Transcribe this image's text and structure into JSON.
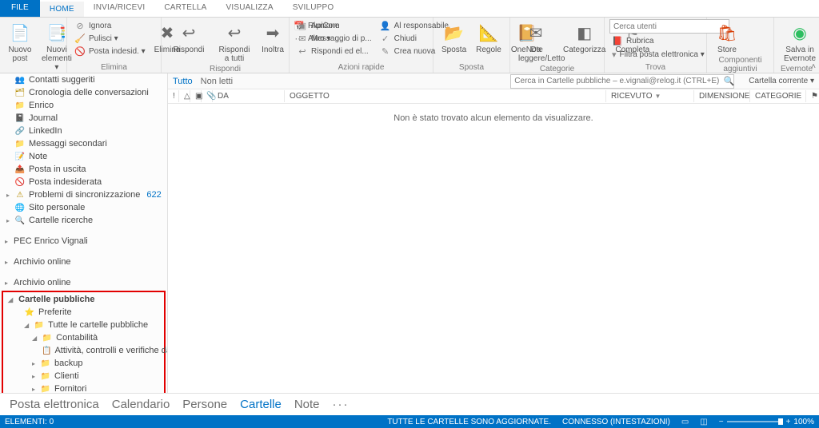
{
  "tabs": {
    "file": "FILE",
    "home": "HOME",
    "send": "INVIA/RICEVI",
    "folder": "CARTELLA",
    "view": "VISUALIZZA",
    "dev": "SVILUPPO"
  },
  "ribbon": {
    "new": {
      "label": "Nuovo",
      "post": "Nuovo post",
      "elements": "Nuovi elementi ▾"
    },
    "delete": {
      "label": "Elimina",
      "ignora": "Ignora",
      "pulisci": "Pulisci ▾",
      "junk": "Posta indesid. ▾",
      "del": "Elimina"
    },
    "respond": {
      "label": "Rispondi",
      "reply": "Rispondi",
      "replyall": "Rispondi a tutti",
      "forward": "Inoltra",
      "meeting": "Riunione",
      "more": "Altro ▾"
    },
    "quick": {
      "label": "Azioni rapide",
      "apicom": "ApiCom",
      "msg": "Messaggio di p...",
      "replyd": "Rispondi ed el...",
      "resp": "Al responsabile",
      "done": "Chiudi",
      "new": "Crea nuova"
    },
    "move": {
      "label": "Sposta",
      "move": "Sposta",
      "rules": "Regole",
      "onenote": "OneNote"
    },
    "tags": {
      "label": "Categorie",
      "unread": "Da leggere/Letto",
      "cat": "Categorizza",
      "flag": "Completa"
    },
    "find": {
      "label": "Trova",
      "placeholder": "Cerca utenti",
      "addr": "Rubrica",
      "filter": "Filtra posta elettronica ▾"
    },
    "addins": {
      "label": "Componenti aggiuntivi",
      "store": "Store"
    },
    "evernote": {
      "label": "Evernote",
      "save": "Salva in Evernote"
    }
  },
  "nav": {
    "items": [
      {
        "caret": "",
        "icon": "👥",
        "label": "Contatti suggeriti"
      },
      {
        "caret": "",
        "icon": "🗂",
        "label": "Cronologia delle conversazioni"
      },
      {
        "caret": "",
        "icon": "📁",
        "label": "Enrico"
      },
      {
        "caret": "",
        "icon": "📓",
        "label": "Journal"
      },
      {
        "caret": "",
        "icon": "🔗",
        "label": "LinkedIn"
      },
      {
        "caret": "",
        "icon": "📁",
        "label": "Messaggi secondari"
      },
      {
        "caret": "",
        "icon": "📝",
        "label": "Note"
      },
      {
        "caret": "",
        "icon": "📤",
        "label": "Posta in uscita"
      },
      {
        "caret": "",
        "icon": "🚫",
        "label": "Posta indesiderata"
      },
      {
        "caret": "▸",
        "icon": "⚠",
        "label": "Problemi di sincronizzazione",
        "count": "622"
      },
      {
        "caret": "",
        "icon": "🌐",
        "label": "Sito personale"
      },
      {
        "caret": "▸",
        "icon": "🔍",
        "label": "Cartelle ricerche"
      }
    ],
    "groups": [
      {
        "label": "PEC Enrico Vignali"
      },
      {
        "label": "Archivio online"
      },
      {
        "label": "Archivio online"
      }
    ]
  },
  "public": {
    "title": "Cartelle pubbliche",
    "fav": "Preferite",
    "all": "Tutte le cartelle pubbliche",
    "cont": "Contabilità",
    "task": "Attività, controlli e verifiche da fare",
    "backup": "backup",
    "clienti": "Clienti",
    "fornitori": "Fornitori"
  },
  "content": {
    "tutto": "Tutto",
    "nonletti": "Non letti",
    "search_ph": "Cerca in Cartelle pubbliche – e.vignali@relog.it (CTRL+E)",
    "current": "Cartella corrente ▾",
    "cols": {
      "da": "DA",
      "ogg": "OGGETTO",
      "ric": "RICEVUTO",
      "dim": "DIMENSIONE",
      "cat": "CATEGORIE"
    },
    "empty": "Non è stato trovato alcun elemento da visualizzare."
  },
  "modules": {
    "mail": "Posta elettronica",
    "cal": "Calendario",
    "people": "Persone",
    "folders": "Cartelle",
    "notes": "Note"
  },
  "status": {
    "items": "ELEMENTI: 0",
    "sync": "TUTTE LE CARTELLE SONO AGGIORNATE.",
    "conn": "CONNESSO (INTESTAZIONI)",
    "zoom": "100%"
  }
}
